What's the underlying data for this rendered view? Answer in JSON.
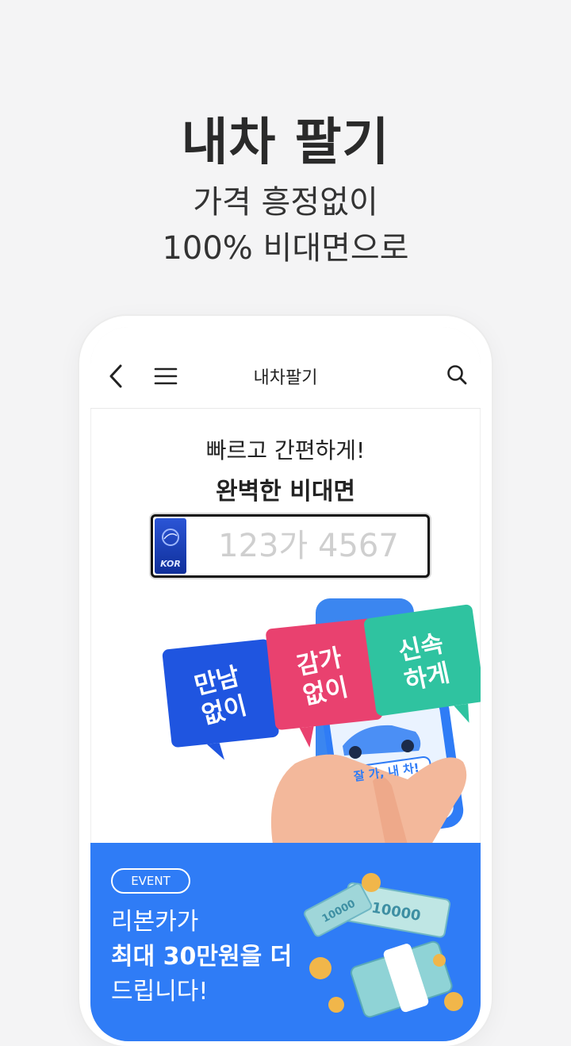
{
  "promo": {
    "title": "내차 팔기",
    "subtitle_line1": "가격 흥정없이",
    "subtitle_line2": "100% 비대면으로"
  },
  "appbar": {
    "title": "내차팔기",
    "back_icon": "chevron-left-icon",
    "menu_icon": "hamburger-menu-icon",
    "search_icon": "search-icon"
  },
  "hero": {
    "line1": "빠르고 간편하게!",
    "line2": "완벽한 비대면"
  },
  "plate_input": {
    "placeholder": "123가 4567",
    "value": "",
    "badge_text": "KOR"
  },
  "illustration": {
    "bubble1": [
      "만남",
      "없이"
    ],
    "bubble2": [
      "감가",
      "없이"
    ],
    "bubble3": [
      "신속",
      "하게"
    ],
    "phone_button": "잘 가, 내 차!",
    "colors": {
      "blue": "#1f55e0",
      "pink": "#e9416f",
      "teal": "#2fc3a0"
    }
  },
  "event_banner": {
    "tag": "EVENT",
    "line1": "리본카가",
    "line2": "최대 30만원을 더",
    "line3": "드립니다!",
    "bill_text": "10000",
    "background": "#2f7cf6"
  }
}
